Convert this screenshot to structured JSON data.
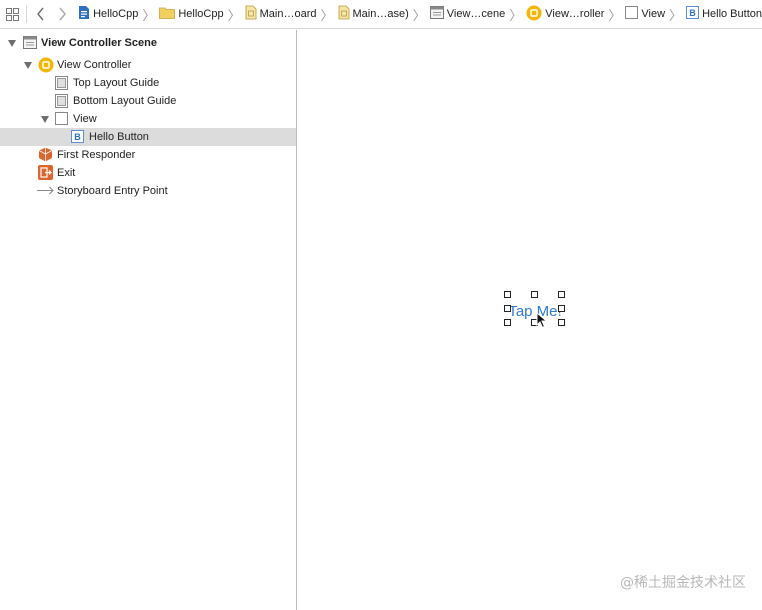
{
  "jumpbar": {
    "crumbs": [
      {
        "label": "HelloCpp",
        "icon": "project-icon"
      },
      {
        "label": "HelloCpp",
        "icon": "folder-icon"
      },
      {
        "label": "Main…oard",
        "icon": "storyboard-file-icon"
      },
      {
        "label": "Main…ase)",
        "icon": "storyboard-base-icon"
      },
      {
        "label": "View…cene",
        "icon": "scene-icon"
      },
      {
        "label": "View…roller",
        "icon": "view-controller-icon"
      },
      {
        "label": "View",
        "icon": "view-icon"
      },
      {
        "label": "Hello Button",
        "icon": "button-icon"
      }
    ]
  },
  "outline": {
    "items": [
      {
        "label": "View Controller Scene",
        "icon": "scene-icon"
      },
      {
        "label": "View Controller",
        "icon": "view-controller-icon"
      },
      {
        "label": "Top Layout Guide",
        "icon": "layout-guide-icon"
      },
      {
        "label": "Bottom Layout Guide",
        "icon": "layout-guide-icon"
      },
      {
        "label": "View",
        "icon": "view-icon"
      },
      {
        "label": "Hello Button",
        "icon": "button-icon",
        "selected": true
      },
      {
        "label": "First Responder",
        "icon": "first-responder-icon"
      },
      {
        "label": "Exit",
        "icon": "exit-icon"
      },
      {
        "label": "Storyboard Entry Point",
        "icon": "entry-point-arrow-icon"
      }
    ]
  },
  "canvas": {
    "button_title": "Tap Me!",
    "watermark": "@稀土掘金技术社区"
  },
  "colors": {
    "accent": "#2f7bd0",
    "selection": "#dcdcdc",
    "view_controller": "#f2b705",
    "first_responder": "#e0652c",
    "exit": "#e0652c"
  }
}
